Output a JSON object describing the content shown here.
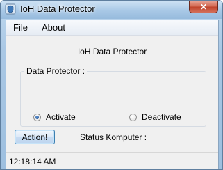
{
  "window": {
    "title": "IoH Data Protector",
    "close_glyph": "✕",
    "app_icon": "shield-app-icon"
  },
  "menu": {
    "items": [
      {
        "label": "File"
      },
      {
        "label": "About"
      }
    ]
  },
  "main": {
    "header": "IoH Data Protector",
    "group_title": "Data Protector :",
    "options": [
      {
        "label": "Activate",
        "checked": true
      },
      {
        "label": "Deactivate",
        "checked": false
      }
    ],
    "action_button": "Action!",
    "status_label": "Status Komputer :"
  },
  "statusbar": {
    "time": "12:18:14 AM"
  }
}
